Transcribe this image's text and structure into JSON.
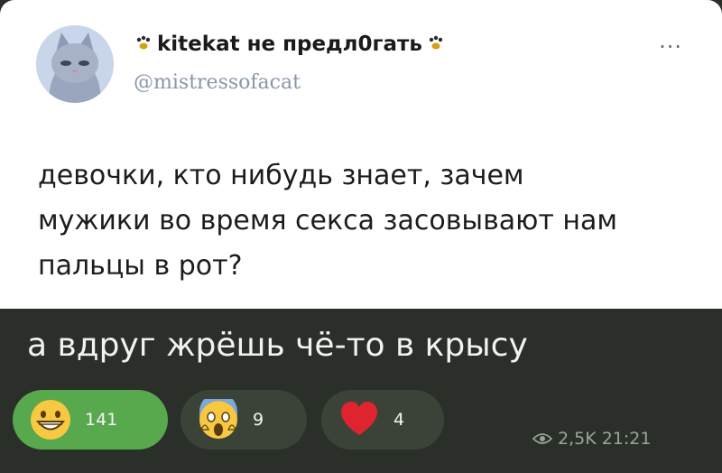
{
  "tweet": {
    "display_name": "kitekat не предл0гать",
    "handle": "@mistressofacat",
    "more_label": "···",
    "text_lines": [
      "девочки, кто нибудь знает, зачем",
      "мужики во время секса засовывают нам",
      "пальцы в рот?"
    ]
  },
  "reply": {
    "text": "а вдруг жрёшь чё-то в крысу"
  },
  "reactions": [
    {
      "emoji": "grinning-face-icon",
      "count": "141",
      "selected": true
    },
    {
      "emoji": "screaming-face-icon",
      "count": "9",
      "selected": false
    },
    {
      "emoji": "red-heart-icon",
      "count": "4",
      "selected": false
    }
  ],
  "message_meta": {
    "views": "2,5K",
    "time": "21:21"
  },
  "colors": {
    "chat_background": "#2a2f29",
    "selected_reaction": "#58a84e",
    "reaction_bubble": "#3b4339"
  }
}
